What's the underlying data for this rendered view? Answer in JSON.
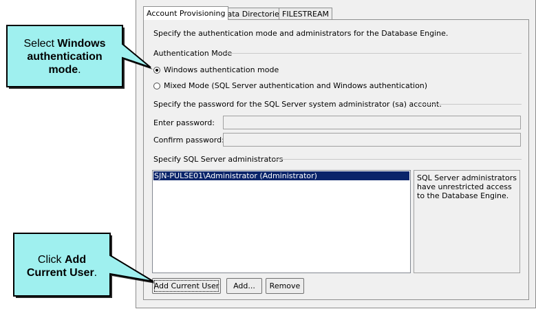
{
  "tabs": [
    "Account Provisioning",
    "Data Directories",
    "FILESTREAM"
  ],
  "description": "Specify the authentication mode and administrators for the Database Engine.",
  "auth_mode": {
    "group_label": "Authentication Mode",
    "windows_label": "Windows authentication mode",
    "mixed_label": "Mixed Mode (SQL Server authentication and Windows authentication)",
    "selected": "windows"
  },
  "password": {
    "group_label": "Specify the password for the SQL Server system administrator (sa) account.",
    "enter_label": "Enter password:",
    "confirm_label": "Confirm password:"
  },
  "admins": {
    "group_label": "Specify SQL Server administrators",
    "items": [
      "SJN-PULSE01\\Administrator (Administrator)"
    ],
    "info": "SQL Server administrators have unrestricted access to the Database Engine."
  },
  "buttons": {
    "add_current_user": "Add Current User",
    "add": "Add...",
    "remove": "Remove"
  },
  "callouts": {
    "windows": {
      "prefix": "Select ",
      "bold": "Windows authentication mode",
      "suffix": "."
    },
    "add_user": {
      "prefix": "Click ",
      "bold": "Add Current User",
      "suffix": "."
    }
  },
  "colors": {
    "callout_fill": "#9ff0ef",
    "selection": "#0a246a"
  }
}
